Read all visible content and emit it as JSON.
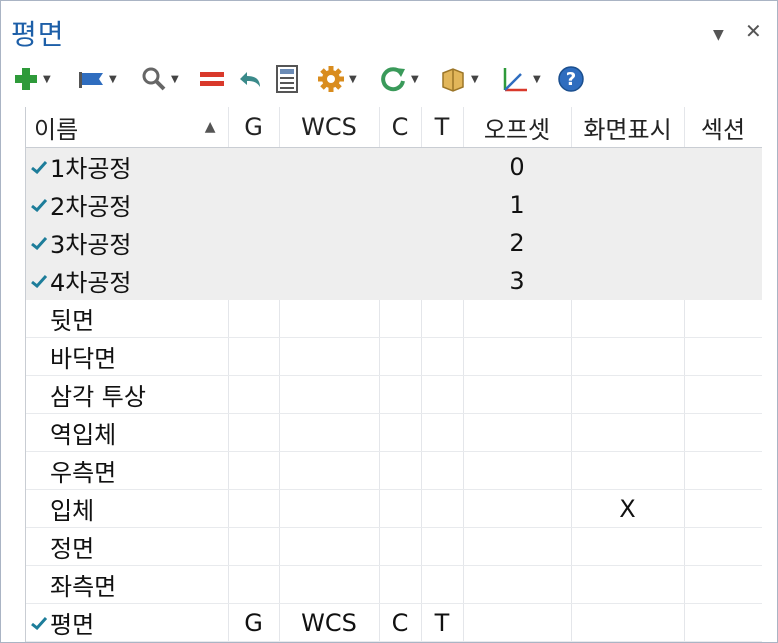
{
  "title": "평면",
  "window_controls": {
    "menu_icon": "dropdown-arrow-icon",
    "close_icon": "close-icon"
  },
  "toolbar": [
    {
      "name": "add-plane-button",
      "icon": "plus-icon",
      "color": "#2e9a3a"
    },
    {
      "name": "flag-button",
      "icon": "flag-icon",
      "color": "#2f6dbf"
    },
    {
      "name": "find-button",
      "icon": "magnifier-icon",
      "color": "#666666"
    },
    {
      "name": "equal-button",
      "icon": "equal-icon",
      "color": "#d9392b"
    },
    {
      "name": "undo-button",
      "icon": "undo-arrow-icon",
      "color": "#3a8a8a"
    },
    {
      "name": "calculator-button",
      "icon": "calculator-icon",
      "color": "#555555"
    },
    {
      "name": "settings-button",
      "icon": "gear-icon",
      "color": "#d98c1e"
    },
    {
      "name": "refresh-button",
      "icon": "refresh-icon",
      "color": "#3a9a5a"
    },
    {
      "name": "view-button",
      "icon": "box-icon",
      "color": "#c89b3c"
    },
    {
      "name": "axis-button",
      "icon": "axis-icon",
      "color": "#555555"
    },
    {
      "name": "help-button",
      "icon": "help-icon",
      "color": "#2f6dbf"
    }
  ],
  "columns": [
    "이름",
    "G",
    "WCS",
    "C",
    "T",
    "오프셋",
    "화면표시",
    "섹션"
  ],
  "rows": [
    {
      "name": "1차공정",
      "checked": true,
      "selected": true,
      "g": "",
      "wcs": "",
      "c": "",
      "t": "",
      "offset": "0",
      "display": "",
      "section": ""
    },
    {
      "name": "2차공정",
      "checked": true,
      "selected": true,
      "g": "",
      "wcs": "",
      "c": "",
      "t": "",
      "offset": "1",
      "display": "",
      "section": ""
    },
    {
      "name": "3차공정",
      "checked": true,
      "selected": true,
      "g": "",
      "wcs": "",
      "c": "",
      "t": "",
      "offset": "2",
      "display": "",
      "section": ""
    },
    {
      "name": "4차공정",
      "checked": true,
      "selected": true,
      "g": "",
      "wcs": "",
      "c": "",
      "t": "",
      "offset": "3",
      "display": "",
      "section": ""
    },
    {
      "name": "뒷면",
      "checked": false,
      "selected": false,
      "g": "",
      "wcs": "",
      "c": "",
      "t": "",
      "offset": "",
      "display": "",
      "section": ""
    },
    {
      "name": "바닥면",
      "checked": false,
      "selected": false,
      "g": "",
      "wcs": "",
      "c": "",
      "t": "",
      "offset": "",
      "display": "",
      "section": ""
    },
    {
      "name": "삼각 투상",
      "checked": false,
      "selected": false,
      "g": "",
      "wcs": "",
      "c": "",
      "t": "",
      "offset": "",
      "display": "",
      "section": ""
    },
    {
      "name": "역입체",
      "checked": false,
      "selected": false,
      "g": "",
      "wcs": "",
      "c": "",
      "t": "",
      "offset": "",
      "display": "",
      "section": ""
    },
    {
      "name": "우측면",
      "checked": false,
      "selected": false,
      "g": "",
      "wcs": "",
      "c": "",
      "t": "",
      "offset": "",
      "display": "",
      "section": ""
    },
    {
      "name": "입체",
      "checked": false,
      "selected": false,
      "g": "",
      "wcs": "",
      "c": "",
      "t": "",
      "offset": "",
      "display": "X",
      "section": ""
    },
    {
      "name": "정면",
      "checked": false,
      "selected": false,
      "g": "",
      "wcs": "",
      "c": "",
      "t": "",
      "offset": "",
      "display": "",
      "section": ""
    },
    {
      "name": "좌측면",
      "checked": false,
      "selected": false,
      "g": "",
      "wcs": "",
      "c": "",
      "t": "",
      "offset": "",
      "display": "",
      "section": ""
    },
    {
      "name": "평면",
      "checked": true,
      "selected": false,
      "g": "G",
      "wcs": "WCS",
      "c": "C",
      "t": "T",
      "offset": "",
      "display": "",
      "section": ""
    }
  ],
  "colors": {
    "title": "#1d5fa8",
    "check": "#1d7d9a",
    "selected_row": "#eeeeee"
  }
}
